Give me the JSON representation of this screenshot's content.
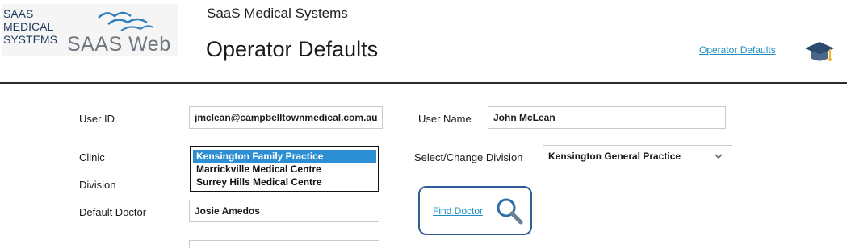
{
  "logo": {
    "lines": [
      "SAAS",
      "MEDICAL",
      "SYSTEMS"
    ],
    "product": "SAAS Web"
  },
  "header": {
    "company": "SaaS Medical Systems",
    "title": "Operator Defaults",
    "link": "Operator Defaults",
    "help_icon": "graduation-cap-icon"
  },
  "form": {
    "user_id": {
      "label": "User ID",
      "value": "jmclean@campbelltownmedical.com.au"
    },
    "user_name": {
      "label": "User Name",
      "value": "John McLean"
    },
    "clinic": {
      "label": "Clinic",
      "options": [
        "Kensington Family Practice",
        "Marrickville Medical Centre",
        "Surrey Hills Medical Centre"
      ],
      "selected_index": 0
    },
    "division": {
      "label": "Division"
    },
    "select_division": {
      "label": "Select/Change Division",
      "value": "Kensington General Practice"
    },
    "default_doctor": {
      "label": "Default Doctor",
      "value": "Josie Amedos"
    },
    "find_doctor": {
      "label": "Find Doctor",
      "icon": "search-icon"
    }
  },
  "colors": {
    "accent_link": "#1f8dc3",
    "selected_row": "#2c8fd3",
    "find_border": "#2f5d96",
    "header_rule": "#2b2b2b"
  }
}
